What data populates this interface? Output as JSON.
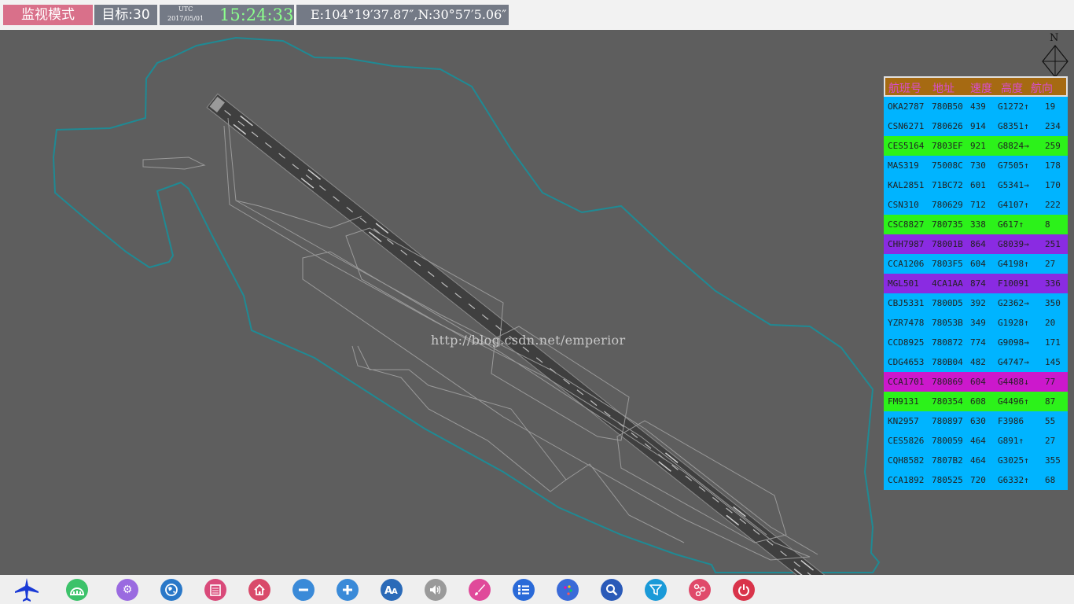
{
  "header": {
    "mode_label": "监视模式",
    "target_count": "目标:30",
    "utc_label": "UTC",
    "utc_date": "2017/05/01",
    "utc_time": "15:24:33",
    "coordinates": "E:104°19′37.87″,N:30°57′5.06″"
  },
  "map": {
    "watermark": "http://blog.csdn.net/emperior",
    "north_label": "N"
  },
  "flight_table": {
    "headers": [
      "航班号",
      "地址",
      "速度",
      "高度",
      "航向"
    ],
    "rows": [
      {
        "callsign": "OKA2787",
        "address": "780B50",
        "speed": "439",
        "altitude": "G1272↑",
        "heading": "19",
        "color": "#00b4ff"
      },
      {
        "callsign": "CSN6271",
        "address": "780626",
        "speed": "914",
        "altitude": "G8351↑",
        "heading": "234",
        "color": "#00b4ff"
      },
      {
        "callsign": "CES5164",
        "address": "7803EF",
        "speed": "921",
        "altitude": "G8824→",
        "heading": "259",
        "color": "#2cf21a"
      },
      {
        "callsign": "MAS319",
        "address": "75008C",
        "speed": "730",
        "altitude": "G7505↑",
        "heading": "178",
        "color": "#00b4ff"
      },
      {
        "callsign": "KAL2851",
        "address": "71BC72",
        "speed": "601",
        "altitude": "G5341→",
        "heading": "170",
        "color": "#00b4ff"
      },
      {
        "callsign": "CSN310",
        "address": "780629",
        "speed": "712",
        "altitude": "G4107↑",
        "heading": "222",
        "color": "#00b4ff"
      },
      {
        "callsign": "CSC8827",
        "address": "780735",
        "speed": "338",
        "altitude": "G617↑",
        "heading": "8",
        "color": "#2cf21a"
      },
      {
        "callsign": "CHH7987",
        "address": "78001B",
        "speed": "864",
        "altitude": "G8039→",
        "heading": "251",
        "color": "#8a2be2"
      },
      {
        "callsign": "CCA1206",
        "address": "7803F5",
        "speed": "604",
        "altitude": "G4198↑",
        "heading": "27",
        "color": "#00b4ff"
      },
      {
        "callsign": "MGL501",
        "address": "4CA1AA",
        "speed": "874",
        "altitude": "F10091",
        "heading": "336",
        "color": "#8a2be2"
      },
      {
        "callsign": "CBJ5331",
        "address": "7800D5",
        "speed": "392",
        "altitude": "G2362→",
        "heading": "350",
        "color": "#00b4ff"
      },
      {
        "callsign": "YZR7478",
        "address": "78053B",
        "speed": "349",
        "altitude": "G1928↑",
        "heading": "20",
        "color": "#00b4ff"
      },
      {
        "callsign": "CCD8925",
        "address": "780872",
        "speed": "774",
        "altitude": "G9098→",
        "heading": "171",
        "color": "#00b4ff"
      },
      {
        "callsign": "CDG4653",
        "address": "780B04",
        "speed": "482",
        "altitude": "G4747→",
        "heading": "145",
        "color": "#00b4ff"
      },
      {
        "callsign": "CCA1701",
        "address": "780869",
        "speed": "604",
        "altitude": "G4488↓",
        "heading": "77",
        "color": "#cc18cc"
      },
      {
        "callsign": "FM9131",
        "address": "780354",
        "speed": "608",
        "altitude": "G4496↑",
        "heading": "87",
        "color": "#2cf21a"
      },
      {
        "callsign": "KN2957",
        "address": "780897",
        "speed": "630",
        "altitude": "F3986",
        "heading": "55",
        "color": "#00b4ff"
      },
      {
        "callsign": "CES5826",
        "address": "780059",
        "speed": "464",
        "altitude": "G891↑",
        "heading": "27",
        "color": "#00b4ff"
      },
      {
        "callsign": "CQH8582",
        "address": "7807B2",
        "speed": "464",
        "altitude": "G3025↑",
        "heading": "355",
        "color": "#00b4ff"
      },
      {
        "callsign": "CCA1892",
        "address": "780525",
        "speed": "720",
        "altitude": "G6332↑",
        "heading": "68",
        "color": "#00b4ff"
      }
    ]
  },
  "toolbar": {
    "tools": [
      {
        "name": "airplane-icon",
        "color": "#1a3ad6"
      },
      {
        "name": "radar-icon",
        "color": "#3cc26a"
      },
      {
        "name": "settings-icon",
        "color": "#9a6ae0"
      },
      {
        "name": "globe-icon",
        "color": "#2a78c8"
      },
      {
        "name": "notepad-icon",
        "color": "#d94a7a"
      },
      {
        "name": "home-icon",
        "color": "#d94a6a"
      },
      {
        "name": "zoom-out-icon",
        "color": "#3a8ad8"
      },
      {
        "name": "zoom-in-icon",
        "color": "#3a8ad8"
      },
      {
        "name": "font-size-icon",
        "color": "#2a6ab8"
      },
      {
        "name": "volume-icon",
        "color": "#9a9a9a"
      },
      {
        "name": "brush-icon",
        "color": "#e04a9a"
      },
      {
        "name": "list-icon",
        "color": "#2a6ad8"
      },
      {
        "name": "palette-icon",
        "color": "#3a6ad8"
      },
      {
        "name": "search-icon",
        "color": "#2a5ab8"
      },
      {
        "name": "filter-icon",
        "color": "#1a9ad8"
      },
      {
        "name": "share-icon",
        "color": "#e04a6a"
      },
      {
        "name": "power-icon",
        "color": "#d9344a"
      }
    ]
  }
}
